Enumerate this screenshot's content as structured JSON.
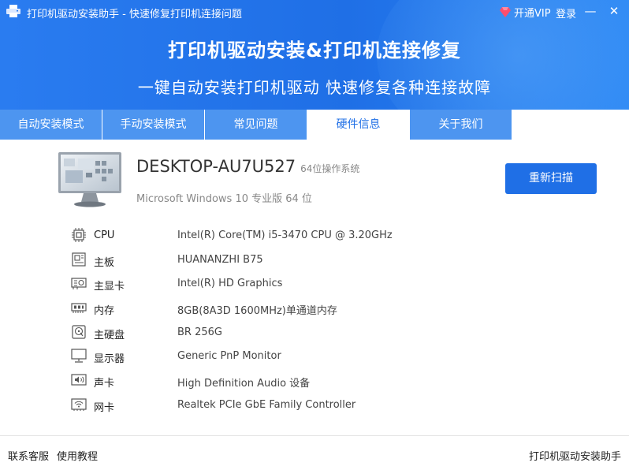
{
  "window": {
    "title": "打印机驱动安装助手 - 快速修复打印机连接问题",
    "vip_label": "开通VIP",
    "login_label": "登录",
    "minimize_glyph": "—",
    "close_glyph": "✕"
  },
  "banner": {
    "headline": "打印机驱动安装&打印机连接修复",
    "subline": "一键自动安装打印机驱动 快速修复各种连接故障"
  },
  "tabs": [
    {
      "label": "自动安装模式"
    },
    {
      "label": "手动安装模式"
    },
    {
      "label": "常见问题"
    },
    {
      "label": "硬件信息",
      "active": true
    },
    {
      "label": "关于我们"
    }
  ],
  "computer": {
    "name": "DESKTOP-AU7U527",
    "os_bits": "64位操作系统",
    "os": "Microsoft Windows 10 专业版 64 位",
    "rescan_label": "重新扫描"
  },
  "hardware": [
    {
      "icon": "cpu-icon",
      "label": "CPU",
      "value": "Intel(R) Core(TM) i5-3470 CPU @ 3.20GHz"
    },
    {
      "icon": "motherboard-icon",
      "label": "主板",
      "value": "HUANANZHI B75"
    },
    {
      "icon": "graphics-card-icon",
      "label": "主显卡",
      "value": "Intel(R) HD Graphics"
    },
    {
      "icon": "memory-icon",
      "label": "内存",
      "value": "8GB(8A3D 1600MHz)单通道内存"
    },
    {
      "icon": "hard-disk-icon",
      "label": "主硬盘",
      "value": "BR 256G"
    },
    {
      "icon": "monitor-icon",
      "label": "显示器",
      "value": "Generic PnP Monitor"
    },
    {
      "icon": "sound-card-icon",
      "label": "声卡",
      "value": "High Definition Audio 设备"
    },
    {
      "icon": "network-card-icon",
      "label": "网卡",
      "value": "Realtek PCIe GbE Family Controller"
    }
  ],
  "footer": {
    "contact": "联系客服",
    "tutorial": "使用教程",
    "app_name": "打印机驱动安装助手"
  },
  "colors": {
    "brand_blue": "#1f6fe6",
    "tab_blue": "#4d95f0",
    "vip_pink": "#ff4d6d"
  }
}
